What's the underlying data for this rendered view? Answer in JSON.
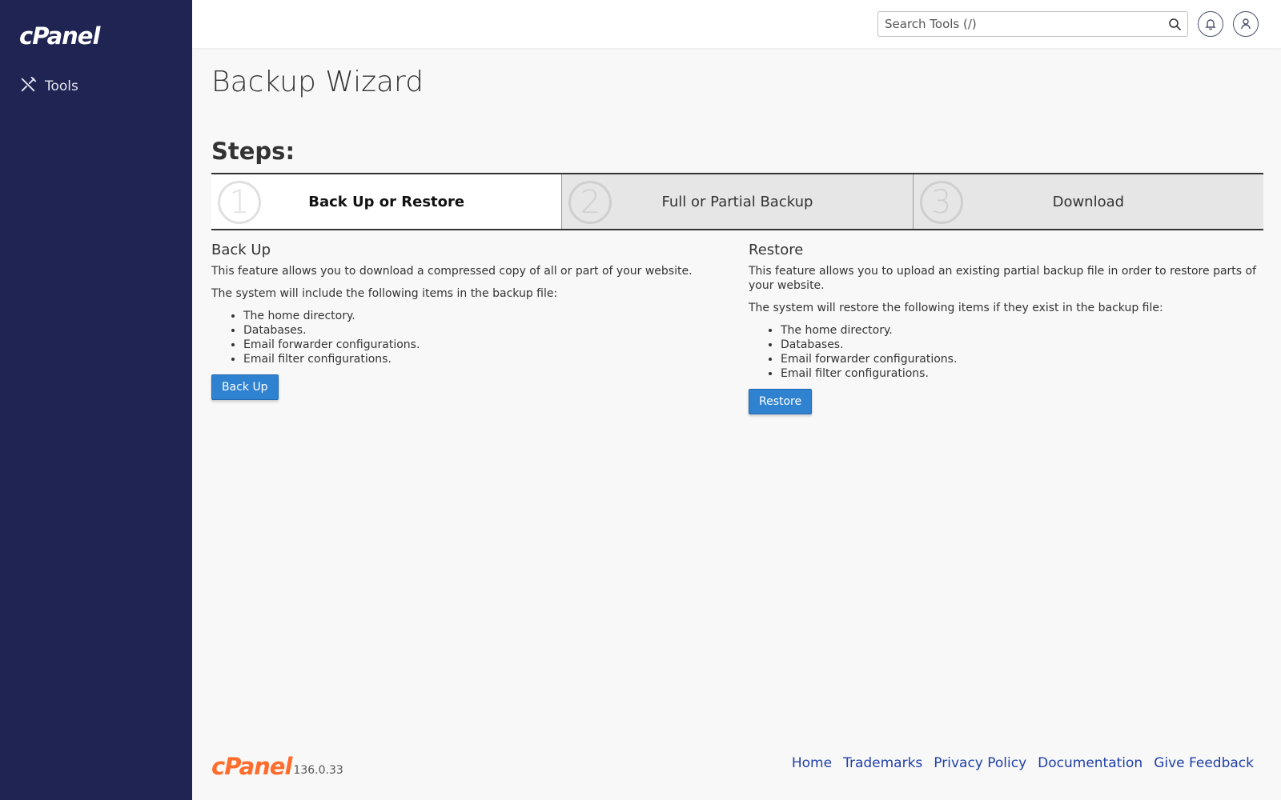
{
  "sidebar": {
    "logo": "cPanel",
    "items": [
      {
        "label": "Tools",
        "icon": "tools-icon"
      }
    ]
  },
  "header": {
    "search_placeholder": "Search Tools (/)",
    "search_icon": "search-icon",
    "notifications_icon": "bell-icon",
    "user_icon": "user-icon"
  },
  "main": {
    "title": "Backup Wizard",
    "steps_heading": "Steps:",
    "steps": [
      {
        "number": "1",
        "label": "Back Up or Restore",
        "active": true
      },
      {
        "number": "2",
        "label": "Full or Partial Backup",
        "active": false
      },
      {
        "number": "3",
        "label": "Download",
        "active": false
      }
    ],
    "backup": {
      "heading": "Back Up",
      "description": "This feature allows you to download a compressed copy of all or part of your website.",
      "intro": "The system will include the following items in the backup file:",
      "items": [
        "The home directory.",
        "Databases.",
        "Email forwarder configurations.",
        "Email filter configurations."
      ],
      "button": "Back Up"
    },
    "restore": {
      "heading": "Restore",
      "description": "This feature allows you to upload an existing partial backup file in order to restore parts of your website.",
      "intro": "The system will restore the following items if they exist in the backup file:",
      "items": [
        "The home directory.",
        "Databases.",
        "Email forwarder configurations.",
        "Email filter configurations."
      ],
      "button": "Restore"
    }
  },
  "footer": {
    "logo": "cPanel",
    "version": "136.0.33",
    "links": [
      "Home",
      "Trademarks",
      "Privacy Policy",
      "Documentation",
      "Give Feedback"
    ]
  },
  "colors": {
    "sidebar_bg": "#1f2452",
    "accent_button": "#2f82d0",
    "footer_brand": "#ff6c2c",
    "link": "#1f3fa8"
  }
}
